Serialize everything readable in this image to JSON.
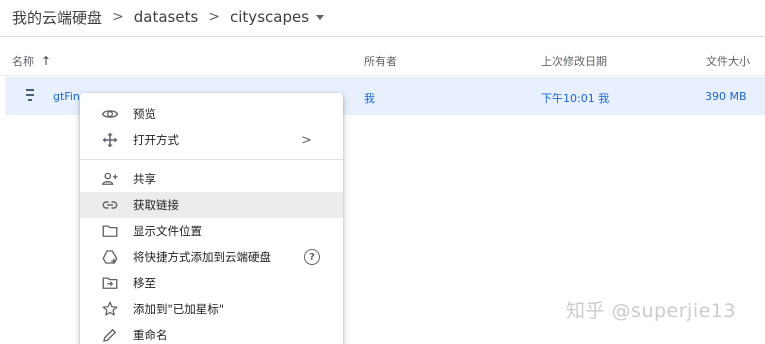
{
  "breadcrumb": {
    "root": "我的云端硬盘",
    "folder1": "datasets",
    "current": "cityscapes",
    "separator": ">"
  },
  "columns": {
    "name": "名称",
    "sort_indicator": "↑",
    "owner": "所有者",
    "last_modified": "上次修改日期",
    "file_size": "文件大小"
  },
  "file": {
    "name": "gtFine",
    "owner": "我",
    "modified": "下午10:01 我",
    "size": "390 MB",
    "icon": "archive-file-icon"
  },
  "context_menu": {
    "preview": "预览",
    "open_with": "打开方式",
    "open_with_chevron": ">",
    "share": "共享",
    "get_link": "获取链接",
    "show_location": "显示文件位置",
    "add_shortcut": "将快捷方式添加到云端硬盘",
    "help_glyph": "?",
    "move_to": "移至",
    "add_starred": "添加到\"已加星标\"",
    "rename": "重命名"
  },
  "watermark": "知乎 @superjie13",
  "colors": {
    "selected_row": "#e8f0fe",
    "selected_text": "#1967d2",
    "menu_hover": "#ececec"
  }
}
